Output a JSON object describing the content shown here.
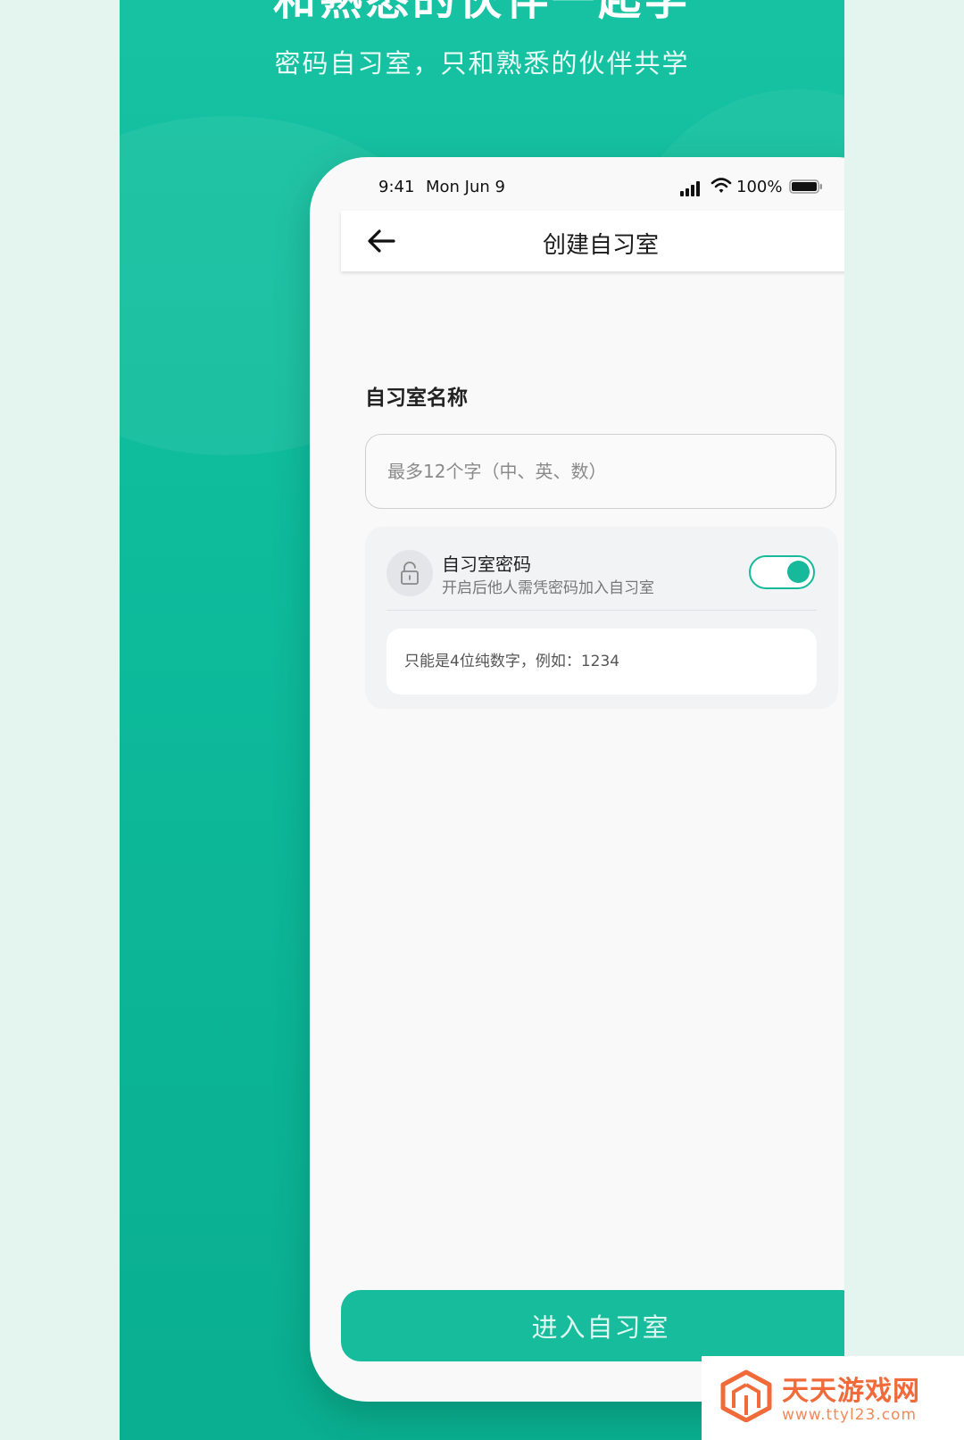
{
  "hero": {
    "title": "和熟悉的伙伴一起学",
    "subtitle": "密码自习室，只和熟悉的伙伴共学"
  },
  "status_bar": {
    "time": "9:41",
    "date": "Mon Jun 9",
    "battery": "100%"
  },
  "nav": {
    "title": "创建自习室"
  },
  "form": {
    "name_label": "自习室名称",
    "name_placeholder": "最多12个字（中、英、数）",
    "name_value": ""
  },
  "password": {
    "title": "自习室密码",
    "description": "开启后他人需凭密码加入自习室",
    "enabled": true,
    "input_placeholder": "只能是4位纯数字，例如：1234"
  },
  "actions": {
    "enter_label": "进入自习室"
  },
  "watermark": {
    "name": "天天游戏网",
    "url": "www.ttyl23.com"
  },
  "colors": {
    "brand": "#16bc9c",
    "watermark": "#f06a3a"
  },
  "icons": [
    "back-arrow-icon",
    "signal-icon",
    "wifi-icon",
    "battery-icon",
    "lock-icon"
  ]
}
